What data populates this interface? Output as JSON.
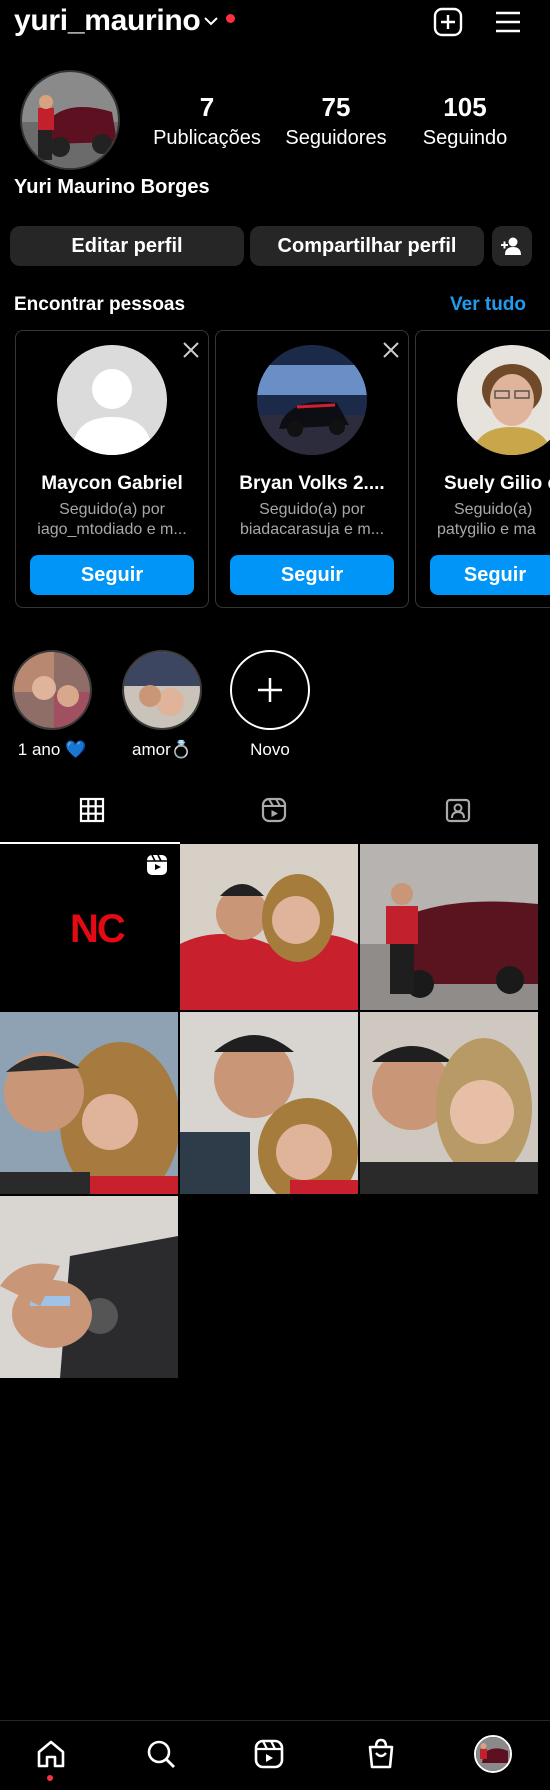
{
  "header": {
    "username": "yuri_maurino",
    "icons": [
      "chevron-down-icon",
      "notification-dot",
      "create-plus-icon",
      "menu-icon"
    ]
  },
  "profile": {
    "full_name": "Yuri Maurino Borges",
    "stats": [
      {
        "value": "7",
        "label": "Publicações"
      },
      {
        "value": "75",
        "label": "Seguidores"
      },
      {
        "value": "105",
        "label": "Seguindo"
      }
    ],
    "edit_label": "Editar perfil",
    "share_label": "Compartilhar perfil"
  },
  "suggestions": {
    "title": "Encontrar pessoas",
    "see_all": "Ver tudo",
    "cards": [
      {
        "name": "Maycon Gabriel",
        "line1": "Seguido(a) por",
        "line2": "iago_mtodiado e m...",
        "follow": "Seguir"
      },
      {
        "name": "Bryan Volks 2....",
        "line1": "Seguido(a) por",
        "line2": "biadacarasuja e m...",
        "follow": "Seguir"
      },
      {
        "name": "Suely Gilio c",
        "line1": "Seguido(a)",
        "line2": "patygilio e ma",
        "follow": "Seguir"
      }
    ]
  },
  "highlights": [
    {
      "label": "1 ano 💙"
    },
    {
      "label": "amor💍"
    },
    {
      "label": "Novo"
    }
  ],
  "tabs": [
    "grid-icon",
    "reels-icon",
    "tagged-icon"
  ],
  "grid": {
    "first_post_text": "NC"
  },
  "colors": {
    "accent": "#0095f6",
    "link": "#1f9bf0",
    "notification": "#ff3040",
    "background": "#000000",
    "button_gray": "#262626"
  },
  "bottom_nav": [
    "home-icon",
    "search-icon",
    "reels-icon",
    "shop-icon",
    "profile-avatar"
  ]
}
